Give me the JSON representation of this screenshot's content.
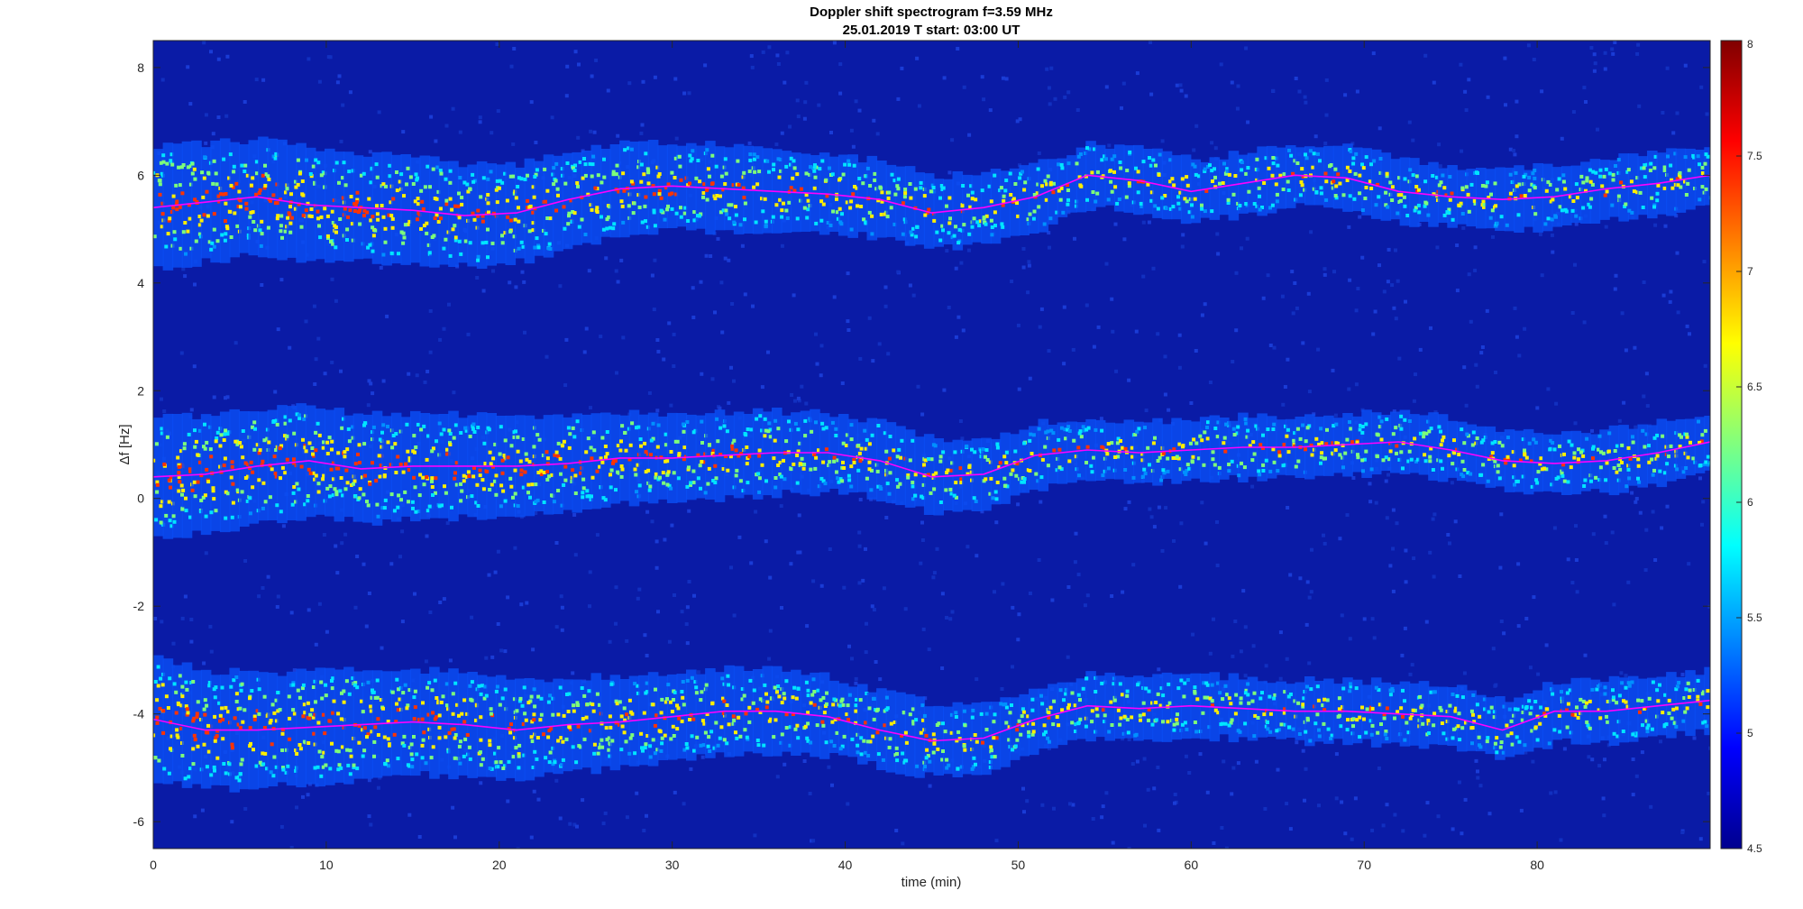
{
  "chart_data": {
    "type": "heatmap",
    "title_line1": "Doppler shift spectrogram f=3.59 MHz",
    "title_line2": "25.01.2019   T start: 03:00 UT",
    "xlabel": "time (min)",
    "ylabel": "Δf [Hz]",
    "xlim": [
      0,
      90
    ],
    "ylim": [
      -6.5,
      8.5
    ],
    "xticks": [
      0,
      10,
      20,
      30,
      40,
      50,
      60,
      70,
      80
    ],
    "yticks": [
      -6,
      -4,
      -2,
      0,
      2,
      4,
      6,
      8
    ],
    "colorbar": {
      "colormap": "jet",
      "range": [
        4.5,
        8
      ],
      "ticks": [
        "4.5",
        "5",
        "5.5",
        "6",
        "6.5",
        "7",
        "7.5",
        "8"
      ]
    },
    "grid": false,
    "series": [
      {
        "line_color": "#ff00ff",
        "time": [
          0,
          3,
          6,
          9,
          12,
          15,
          18,
          21,
          24,
          27,
          30,
          33,
          36,
          39,
          42,
          45,
          48,
          51,
          54,
          57,
          60,
          63,
          66,
          69,
          72,
          75,
          78,
          81,
          84,
          87,
          90
        ],
        "freq": [
          5.4,
          5.5,
          5.6,
          5.45,
          5.4,
          5.35,
          5.25,
          5.3,
          5.55,
          5.75,
          5.8,
          5.75,
          5.7,
          5.65,
          5.55,
          5.3,
          5.4,
          5.6,
          6.0,
          5.9,
          5.7,
          5.85,
          6.0,
          5.95,
          5.7,
          5.6,
          5.55,
          5.6,
          5.75,
          5.85,
          6.0
        ]
      },
      {
        "line_color": "#ff00ff",
        "time": [
          0,
          3,
          6,
          9,
          12,
          15,
          18,
          21,
          24,
          27,
          30,
          33,
          36,
          39,
          42,
          45,
          48,
          51,
          54,
          57,
          60,
          63,
          66,
          69,
          72,
          75,
          78,
          81,
          84,
          87,
          90
        ],
        "freq": [
          0.4,
          0.45,
          0.6,
          0.7,
          0.55,
          0.6,
          0.6,
          0.6,
          0.65,
          0.75,
          0.75,
          0.8,
          0.85,
          0.85,
          0.7,
          0.4,
          0.45,
          0.8,
          0.9,
          0.85,
          0.9,
          0.95,
          0.95,
          1.0,
          1.05,
          0.9,
          0.7,
          0.65,
          0.7,
          0.85,
          1.05
        ]
      },
      {
        "line_color": "#ff00ff",
        "time": [
          0,
          3,
          6,
          9,
          12,
          15,
          18,
          21,
          24,
          27,
          30,
          33,
          36,
          39,
          42,
          45,
          48,
          51,
          54,
          57,
          60,
          63,
          66,
          69,
          72,
          75,
          78,
          81,
          84,
          87,
          90
        ],
        "freq": [
          -4.1,
          -4.3,
          -4.3,
          -4.25,
          -4.2,
          -4.15,
          -4.2,
          -4.3,
          -4.2,
          -4.15,
          -4.05,
          -3.95,
          -3.95,
          -4.05,
          -4.3,
          -4.5,
          -4.45,
          -4.1,
          -3.85,
          -3.9,
          -3.85,
          -3.9,
          -3.95,
          -3.95,
          -4.0,
          -4.05,
          -4.3,
          -3.95,
          -3.95,
          -3.85,
          -3.75
        ]
      }
    ]
  }
}
